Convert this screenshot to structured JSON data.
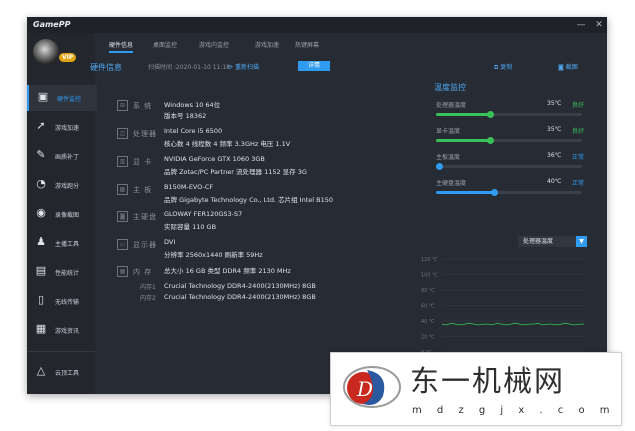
{
  "app": {
    "title": "GamePP",
    "vip_badge": "VIP"
  },
  "window": {
    "min_glyph": "—",
    "close_glyph": "✕"
  },
  "sidebar": {
    "items": [
      {
        "label": "硬件监控",
        "icon": "monitor-icon",
        "glyph": "▣"
      },
      {
        "label": "游戏加速",
        "icon": "rocket-icon",
        "glyph": "➚"
      },
      {
        "label": "画质补丁",
        "icon": "patch-icon",
        "glyph": "✎"
      },
      {
        "label": "游戏跑分",
        "icon": "gauge-icon",
        "glyph": "◔"
      },
      {
        "label": "录像截图",
        "icon": "camera-icon",
        "glyph": "◉"
      },
      {
        "label": "主播工具",
        "icon": "user-icon",
        "glyph": "♟"
      },
      {
        "label": "性能统计",
        "icon": "clipboard-icon",
        "glyph": "▤"
      },
      {
        "label": "无线传输",
        "icon": "phone-icon",
        "glyph": "▯"
      },
      {
        "label": "游戏资讯",
        "icon": "news-icon",
        "glyph": "▦"
      }
    ],
    "bottom": {
      "label": "云顶工具",
      "icon": "cloud-tool-icon",
      "glyph": "△"
    }
  },
  "tabs": [
    "硬件信息",
    "桌面监控",
    "游戏内监控",
    "游戏加速",
    "热键屏幕"
  ],
  "hardware": {
    "title": "硬件信息",
    "scan_time": "扫描时间 :2020-01-10 11:18",
    "rescan": "重新扫描",
    "details": "详情",
    "rows": [
      {
        "label": "系  统",
        "icon": "os-icon",
        "glyph": "⊞",
        "lines": [
          "Windows 10  64位",
          "版本号 18362"
        ]
      },
      {
        "label": "处理器",
        "icon": "cpu-icon",
        "glyph": "◫",
        "lines": [
          "Intel Core i5 6500",
          "核心数  4     线程数  4     频率  3.3GHz     电压  1.1V"
        ]
      },
      {
        "label": "显  卡",
        "icon": "gpu-icon",
        "glyph": "▥",
        "lines": [
          "NVIDIA GeForce GTX 1060 3GB",
          "品牌  Zotac/PC Partner    流处理器  1152    显存  3G"
        ]
      },
      {
        "label": "主  板",
        "icon": "motherboard-icon",
        "glyph": "▩",
        "lines": [
          "B150M-EVO-CF",
          "品牌  Gigabyte Technology Co., Ltd.     芯片组  Intel B150"
        ]
      },
      {
        "label": "主硬盘",
        "icon": "disk-icon",
        "glyph": "◙",
        "lines": [
          "GLOWAY FER120GS3-S7",
          "实际容量  110 GB"
        ]
      },
      {
        "label": "显示器",
        "icon": "display-icon",
        "glyph": "▭",
        "lines": [
          "DVI",
          "分辨率  2560x1440     刷新率  59Hz"
        ]
      },
      {
        "label": "内  存",
        "icon": "memory-icon",
        "glyph": "▦",
        "lines": [
          "总大小  16 GB     类型  DDR4     频率  2130 MHz"
        ]
      }
    ],
    "memory_slots": [
      {
        "label": "内存1",
        "value": "Crucial Technology DDR4-2400(2130MHz) 8GB"
      },
      {
        "label": "内存2",
        "value": "Crucial Technology DDR4-2400(2130MHz) 8GB"
      }
    ]
  },
  "toolbar": {
    "copy": "复制",
    "screenshot": "截图"
  },
  "temperature": {
    "title": "温度监控",
    "items": [
      {
        "name": "处理器温度",
        "value": "35℃",
        "status": "良好",
        "level": 0.37,
        "color": "#39c25a",
        "status_color": "#39c25a"
      },
      {
        "name": "显卡温度",
        "value": "35℃",
        "status": "良好",
        "level": 0.37,
        "color": "#39c25a",
        "status_color": "#39c25a"
      },
      {
        "name": "主板温度",
        "value": "36℃",
        "status": "正常",
        "level": 0.02,
        "color": "#2f9bf1",
        "status_color": "#2f9bf1"
      },
      {
        "name": "主硬盘温度",
        "value": "40℃",
        "status": "正常",
        "level": 0.4,
        "color": "#2f9bf1",
        "status_color": "#2f9bf1"
      }
    ],
    "select": "处理器温度"
  },
  "chart_data": {
    "type": "line",
    "y_ticks": [
      "120 ℃",
      "100 ℃",
      "80 ℃",
      "60 ℃",
      "40 ℃",
      "20 ℃",
      "0 ℃"
    ],
    "ylim": [
      0,
      120
    ],
    "grid": true,
    "line_color": "#39c25a",
    "series": [
      {
        "values": [
          36,
          35,
          37,
          36,
          35,
          36,
          37,
          36,
          35,
          36,
          36,
          35,
          37,
          36,
          35,
          36,
          37,
          36,
          35,
          36,
          36,
          37,
          35,
          36,
          36,
          35,
          36,
          37,
          36,
          35,
          36,
          36
        ]
      }
    ]
  },
  "watermark": {
    "name": "东一机械网",
    "url": "m d z g j x . c o m"
  }
}
